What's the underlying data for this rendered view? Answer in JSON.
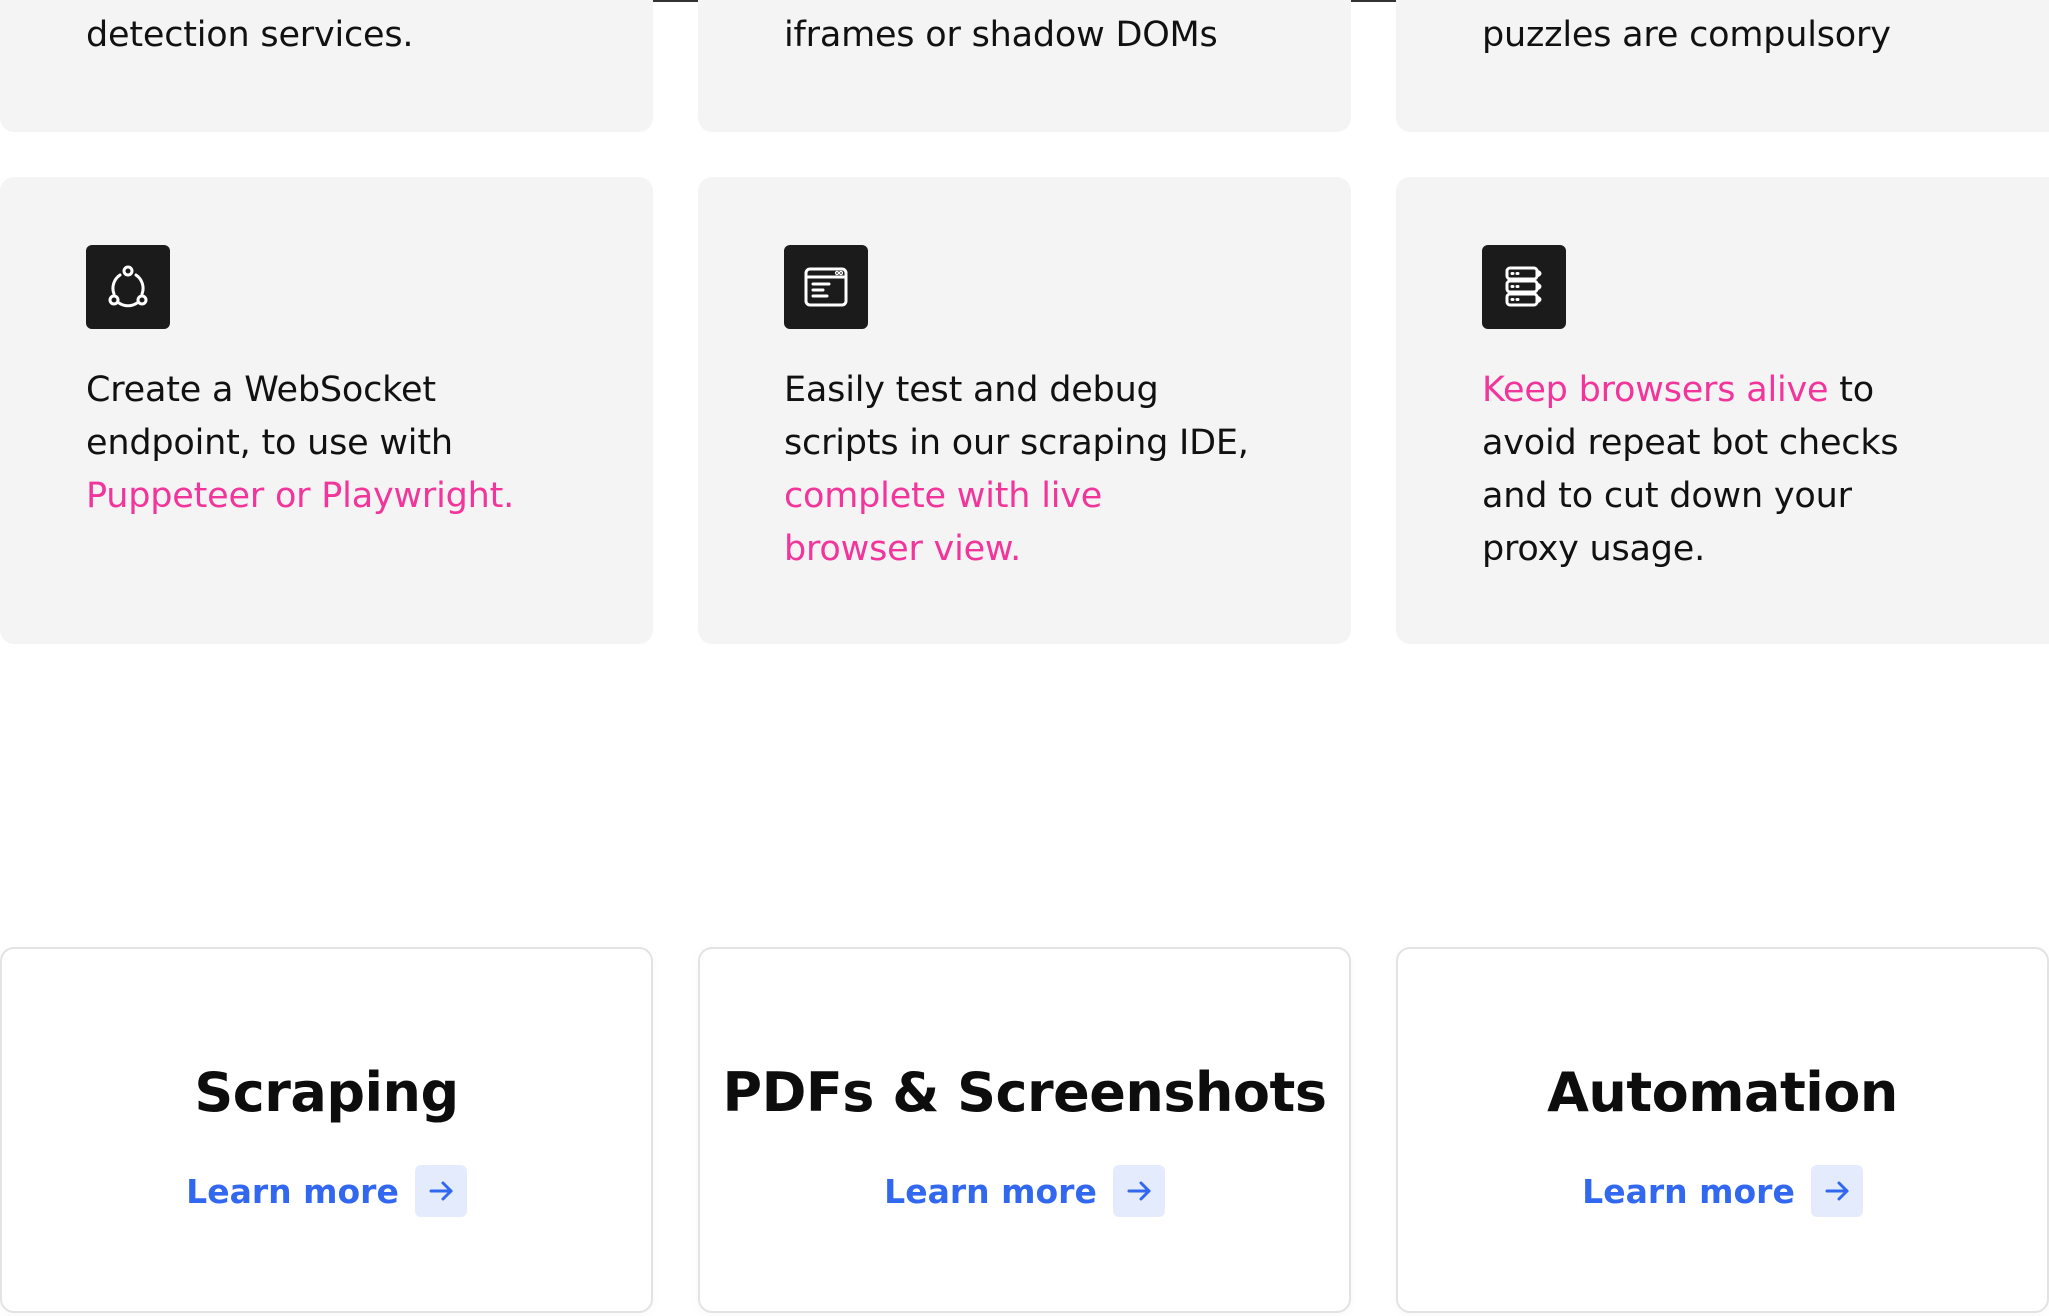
{
  "top_cards": [
    {
      "text": "detection services."
    },
    {
      "text": "iframes or shadow DOMs"
    },
    {
      "text": "puzzles are compulsory"
    }
  ],
  "feature_cards": [
    {
      "icon": "websocket-icon",
      "lines": [
        {
          "parts": [
            {
              "text": "Create a WebSocket",
              "highlight": false
            }
          ]
        },
        {
          "parts": [
            {
              "text": "endpoint, to use with",
              "highlight": false
            }
          ]
        },
        {
          "parts": [
            {
              "text": "Puppeteer or Playwright.",
              "highlight": true
            }
          ]
        }
      ]
    },
    {
      "icon": "ide-window-icon",
      "lines": [
        {
          "parts": [
            {
              "text": "Easily test and debug",
              "highlight": false
            }
          ]
        },
        {
          "parts": [
            {
              "text": "scripts in our scraping IDE,",
              "highlight": false
            }
          ]
        },
        {
          "parts": [
            {
              "text": "complete with live",
              "highlight": true
            }
          ]
        },
        {
          "parts": [
            {
              "text": "browser view.",
              "highlight": true
            }
          ]
        }
      ]
    },
    {
      "icon": "server-stack-icon",
      "lines": [
        {
          "parts": [
            {
              "text": "Keep browsers alive",
              "highlight": true
            },
            {
              "text": " to",
              "highlight": false
            }
          ]
        },
        {
          "parts": [
            {
              "text": "avoid repeat bot checks",
              "highlight": false
            }
          ]
        },
        {
          "parts": [
            {
              "text": "and to cut down your",
              "highlight": false
            }
          ]
        },
        {
          "parts": [
            {
              "text": "proxy usage.",
              "highlight": false
            }
          ]
        }
      ]
    }
  ],
  "link_cards": [
    {
      "title": "Scraping",
      "link_label": "Learn more",
      "arrow_icon": "arrow-right-icon"
    },
    {
      "title": "PDFs & Screenshots",
      "link_label": "Learn more",
      "arrow_icon": "arrow-right-icon"
    },
    {
      "title": "Automation",
      "link_label": "Learn more",
      "arrow_icon": "arrow-right-icon"
    }
  ],
  "colors": {
    "highlight": "#f2359b",
    "link": "#3268f0",
    "card_background": "#f4f4f4",
    "icon_background": "#1b1b1b",
    "arrow_background": "#e4ebfd"
  }
}
